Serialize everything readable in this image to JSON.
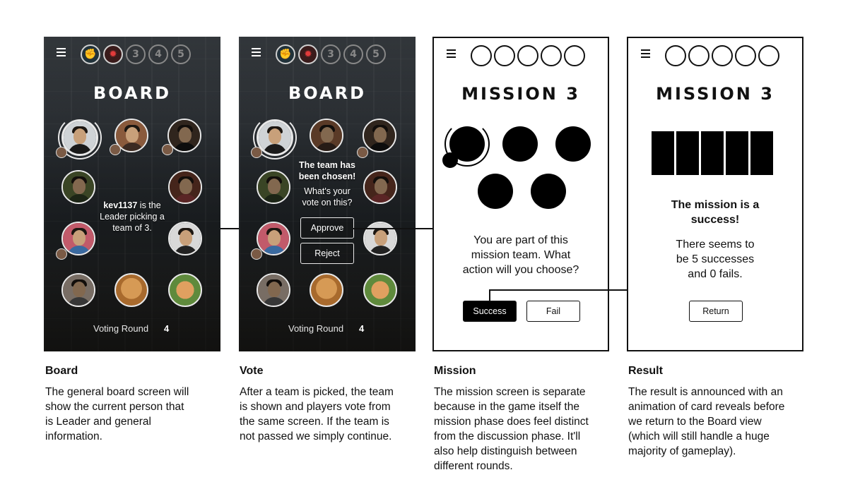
{
  "board": {
    "round_tokens": [
      "",
      "",
      "3",
      "4",
      "5"
    ],
    "title": "BOARD",
    "leader_name": "kev1137",
    "leader_text_1": " is the",
    "leader_text_2": "Leader picking a",
    "leader_text_3": "team of 3.",
    "voting_round_label": "Voting Round",
    "voting_round_value": "4"
  },
  "vote": {
    "round_tokens": [
      "",
      "",
      "3",
      "4",
      "5"
    ],
    "title": "BOARD",
    "chosen_line_1": "The team has",
    "chosen_line_2": "been chosen!",
    "question_line_1": "What's your",
    "question_line_2": "vote on this?",
    "approve_label": "Approve",
    "reject_label": "Reject",
    "voting_round_label": "Voting Round",
    "voting_round_value": "4"
  },
  "mission": {
    "title": "MISSION 3",
    "prompt_line_1": "You are part of this",
    "prompt_line_2": "mission team. What",
    "prompt_line_3": "action will you choose?",
    "success_label": "Success",
    "fail_label": "Fail"
  },
  "result": {
    "title": "MISSION 3",
    "headline_line_1": "The mission is a",
    "headline_line_2": "success!",
    "detail_line_1": "There seems to",
    "detail_line_2": "be 5 successes",
    "detail_line_3": "and 0 fails.",
    "return_label": "Return"
  },
  "captions": {
    "board": {
      "heading": "Board",
      "lines": [
        "The general board screen will",
        "show the current person that",
        "is Leader and general",
        "information."
      ]
    },
    "vote": {
      "heading": "Vote",
      "lines": [
        "After a team is picked, the team",
        "is shown and players vote from",
        "the same screen. If the team is",
        "not passed we simply continue."
      ]
    },
    "mission": {
      "heading": "Mission",
      "lines": [
        "The mission screen is separate",
        "because in the game itself the",
        "mission phase does feel distinct",
        "from the discussion phase. It'll",
        "also help distinguish between",
        "different rounds."
      ]
    },
    "result": {
      "heading": "Result",
      "lines": [
        "The result is announced with an",
        "animation of card reveals before",
        "we return to the Board view",
        "(which will still handle a huge",
        "majority of gameplay)."
      ]
    }
  },
  "colors": {
    "resistance_blue": "#3ec7d8",
    "spy_red": "#e23b3b",
    "ink": "#111111"
  }
}
